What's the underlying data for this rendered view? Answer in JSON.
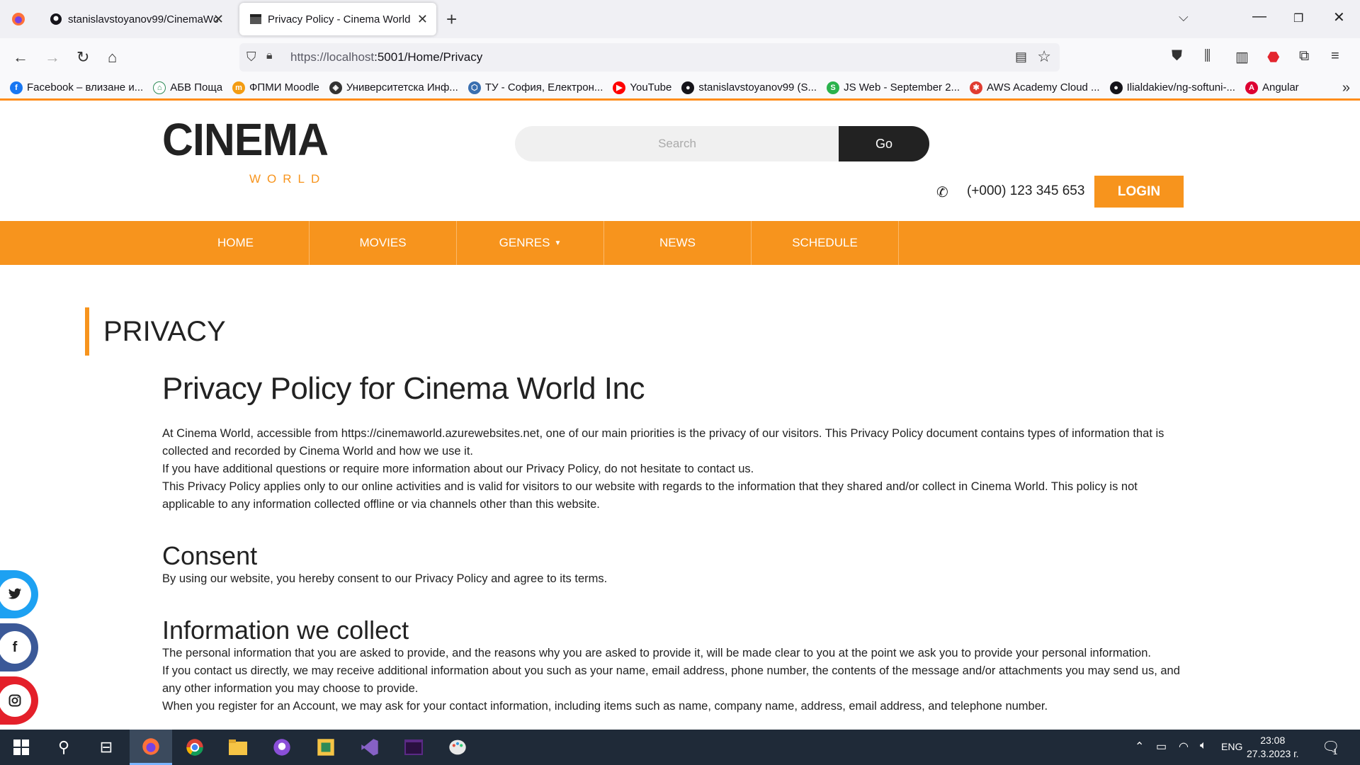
{
  "browser": {
    "tabs": [
      {
        "title": "stanislavstoyanov99/CinemaWo",
        "icon": "github-icon"
      },
      {
        "title": "Privacy Policy - Cinema World",
        "icon": "clapperboard-icon"
      }
    ],
    "url_host": "https://localhost",
    "url_rest": ":5001/Home/Privacy",
    "bookmarks": [
      {
        "label": "Facebook – влизане и...",
        "color": "#1877f2",
        "glyph": "f"
      },
      {
        "label": "АБВ Поща",
        "color": "#ffffff",
        "glyph": "⌂"
      },
      {
        "label": "ФПМИ Moodle",
        "color": "#f39c12",
        "glyph": "m"
      },
      {
        "label": "Университетска Инф...",
        "color": "#333333",
        "glyph": "◈"
      },
      {
        "label": "ТУ - София, Електрон...",
        "color": "#3a6fb0",
        "glyph": "⬡"
      },
      {
        "label": "YouTube",
        "color": "#ff0000",
        "glyph": "▶"
      },
      {
        "label": "stanislavstoyanov99 (S...",
        "color": "#15141a",
        "glyph": "●"
      },
      {
        "label": "JS Web - September 2...",
        "color": "#2bb24c",
        "glyph": "S"
      },
      {
        "label": "AWS Academy Cloud ...",
        "color": "#e03c31",
        "glyph": "✱"
      },
      {
        "label": "Ilialdakiev/ng-softuni-...",
        "color": "#15141a",
        "glyph": "●"
      },
      {
        "label": "Angular",
        "color": "#dd0031",
        "glyph": "A"
      }
    ]
  },
  "header": {
    "logo_main": "CINEMA",
    "logo_sub": "WORLD",
    "search_placeholder": "Search",
    "search_button": "Go",
    "phone": "(+000) 123 345 653",
    "login": "LOGIN"
  },
  "nav": [
    {
      "label": "HOME"
    },
    {
      "label": "MOVIES"
    },
    {
      "label": "GENRES"
    },
    {
      "label": "NEWS"
    },
    {
      "label": "SCHEDULE"
    }
  ],
  "page": {
    "heading": "PRIVACY",
    "title": "Privacy Policy for Cinema World Inc",
    "intro": [
      "At Cinema World, accessible from https://cinemaworld.azurewebsites.net, one of our main priorities is the privacy of our visitors. This Privacy Policy document contains types of information that is collected and recorded by Cinema World and how we use it.",
      "If you have additional questions or require more information about our Privacy Policy, do not hesitate to contact us.",
      "This Privacy Policy applies only to our online activities and is valid for visitors to our website with regards to the information that they shared and/or collect in Cinema World. This policy is not applicable to any information collected offline or via channels other than this website."
    ],
    "consent_title": "Consent",
    "consent_text": "By using our website, you hereby consent to our Privacy Policy and agree to its terms.",
    "collect_title": "Information we collect",
    "collect": [
      "The personal information that you are asked to provide, and the reasons why you are asked to provide it, will be made clear to you at the point we ask you to provide your personal information.",
      "If you contact us directly, we may receive additional information about you such as your name, email address, phone number, the contents of the message and/or attachments you may send us, and any other information you may choose to provide.",
      "When you register for an Account, we may ask for your contact information, including items such as name, company name, address, email address, and telephone number."
    ]
  },
  "social": [
    {
      "name": "twitter",
      "color": "#1da1f2",
      "glyph": "𝕥"
    },
    {
      "name": "facebook",
      "color": "#3b5998",
      "glyph": "f"
    },
    {
      "name": "instagram",
      "color": "#e4202a",
      "glyph": "◎"
    }
  ],
  "colors": {
    "accent": "#f7941d",
    "dark": "#222222"
  },
  "taskbar": {
    "lang": "ENG",
    "time": "23:08",
    "date": "27.3.2023 г.",
    "notifications": "1"
  }
}
